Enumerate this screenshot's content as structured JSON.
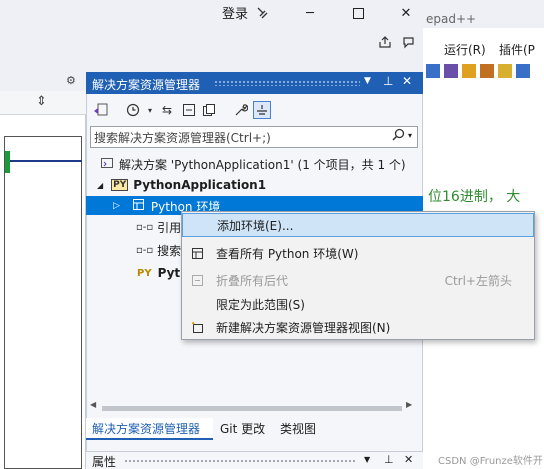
{
  "titlebar": {
    "login_label": "登录",
    "tab_fragment": "epad++"
  },
  "menu": {
    "run_label": "运行(R)",
    "plugins_label": "插件(P"
  },
  "editor": {
    "code_fragment": "位16进制， 大"
  },
  "solution_explorer": {
    "title": "解决方案资源管理器",
    "search_placeholder": "搜索解决方案资源管理器(Ctrl+;)",
    "tree": {
      "solution": "解决方案 'PythonApplication1' (1 个项目，共 1 个)",
      "project": "PythonApplication1",
      "python_env": "Python 环境",
      "references": "引用",
      "search_paths": "搜索",
      "py_file": "Pyth"
    },
    "tabs": {
      "solution_explorer": "解决方案资源管理器",
      "git": "Git 更改",
      "class_view": "类视图"
    }
  },
  "properties": {
    "title": "属性"
  },
  "context_menu": {
    "items": [
      {
        "label": "添加环境(E)...",
        "shortcut": "",
        "disabled": false,
        "highlighted": true
      },
      {
        "label": "查看所有 Python 环境(W)",
        "shortcut": "",
        "disabled": false,
        "highlighted": false
      },
      {
        "label": "折叠所有后代",
        "shortcut": "Ctrl+左箭头",
        "disabled": true,
        "highlighted": false
      },
      {
        "label": "限定为此范围(S)",
        "shortcut": "",
        "disabled": false,
        "highlighted": false
      },
      {
        "label": "新建解决方案资源管理器视图(N)",
        "shortcut": "",
        "disabled": false,
        "highlighted": false
      }
    ]
  },
  "watermark": "CSDN @Frunze软件开发",
  "colors": {
    "accent": "#0078d7",
    "title_blue": "#1f5fb4"
  }
}
